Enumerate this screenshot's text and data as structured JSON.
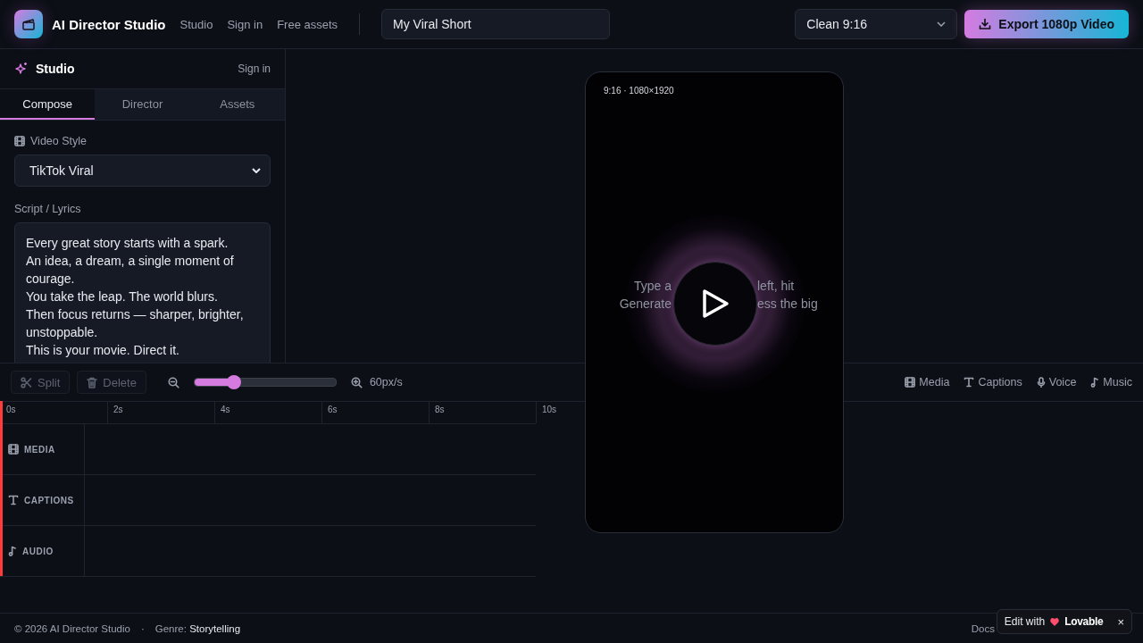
{
  "header": {
    "app_name": "AI Director Studio",
    "nav": [
      "Studio",
      "Sign in",
      "Free assets"
    ],
    "project_title": "My Viral Short",
    "preset": "Clean 9:16",
    "export_button": "Export 1080p Video"
  },
  "sidebar": {
    "title": "Studio",
    "sign_in": "Sign in",
    "tabs": [
      {
        "label": "Compose",
        "selected": true
      },
      {
        "label": "Director",
        "selected": false
      },
      {
        "label": "Assets",
        "selected": false
      }
    ],
    "video_style_label": "Video Style",
    "video_style": "TikTok Viral",
    "script_label": "Script / Lyrics",
    "script": "Every great story starts with a spark.\nAn idea, a dream, a single moment of courage.\nYou take the leap. The world blurs.\nThen focus returns — sharper, brighter, unstoppable.\nThis is your movie. Direct it."
  },
  "preview": {
    "format": "9:16 · 1080×1920",
    "hint_left": [
      "Type a",
      "Generate"
    ],
    "hint_right": [
      "left, hit",
      "ess the big"
    ]
  },
  "timeline": {
    "tools": [
      {
        "kind": "split",
        "label": "Split",
        "disabled": true
      },
      {
        "kind": "delete",
        "label": "Delete",
        "disabled": true
      }
    ],
    "zoom": {
      "level": 0.28,
      "reading": "60px/s"
    },
    "layers": [
      {
        "kind": "media",
        "label": "Media"
      },
      {
        "kind": "captions",
        "label": "Captions"
      },
      {
        "kind": "voice",
        "label": "Voice"
      },
      {
        "kind": "music",
        "label": "Music"
      }
    ],
    "ruler": [
      "0s",
      "2s",
      "4s",
      "6s",
      "8s",
      "10s"
    ],
    "tracks": [
      {
        "kind": "media",
        "label": "MEDIA"
      },
      {
        "kind": "captions",
        "label": "CAPTIONS"
      },
      {
        "kind": "audio",
        "label": "AUDIO"
      }
    ]
  },
  "footer": {
    "copyright": "© 2026 AI Director Studio",
    "separator": "·",
    "genre_label": "Genre:",
    "genre": "Storytelling",
    "links": [
      "Docs"
    ]
  },
  "badge": {
    "text": "Edit with",
    "brand": "Lovable",
    "close": "×"
  }
}
